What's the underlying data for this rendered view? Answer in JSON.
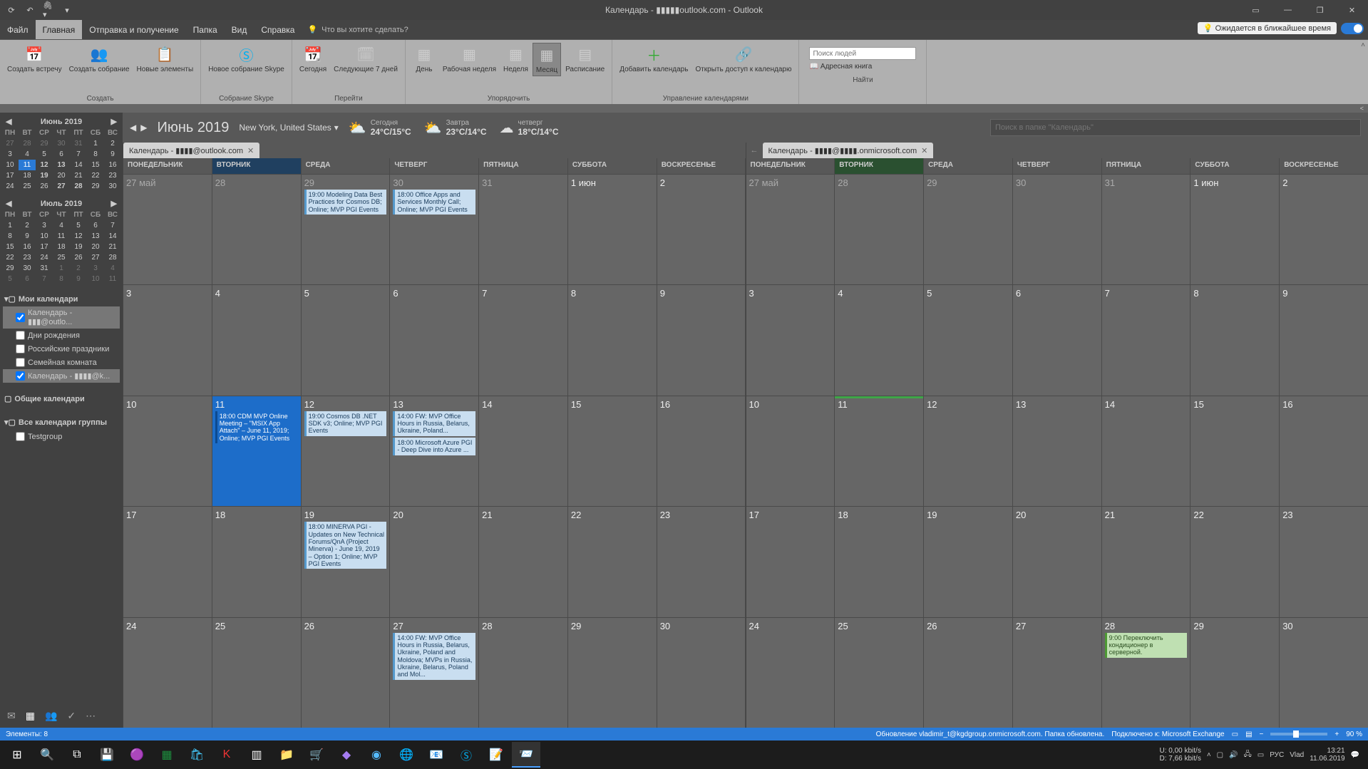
{
  "titlebar": {
    "title": "Календарь - ▮▮▮▮▮outlook.com - Outlook"
  },
  "menu": {
    "items": [
      "Файл",
      "Главная",
      "Отправка и получение",
      "Папка",
      "Вид",
      "Справка"
    ],
    "active": 1,
    "tellme": "Что вы хотите сделать?",
    "waiting": "Ожидается в ближайшее время"
  },
  "ribbon": {
    "g1": {
      "label": "Создать",
      "b1": "Создать\nвстречу",
      "b2": "Создать\nсобрание",
      "b3": "Новые\nэлементы"
    },
    "g2": {
      "label": "Собрание Skype",
      "b1": "Новое\nсобрание Skype"
    },
    "g3": {
      "label": "Перейти",
      "b1": "Сегодня",
      "b2": "Следующие\n7 дней"
    },
    "g4": {
      "label": "Упорядочить",
      "b1": "День",
      "b2": "Рабочая\nнеделя",
      "b3": "Неделя",
      "b4": "Месяц",
      "b5": "Расписание"
    },
    "g5": {
      "label": "Управление календарями",
      "b1": "Добавить\nкалендарь",
      "b2": "Открыть доступ\nк календарю"
    },
    "g6": {
      "label": "Найти",
      "search_ph": "Поиск людей",
      "addrbook": "Адресная книга"
    }
  },
  "sidebar": {
    "cal1": {
      "title": "Июнь 2019",
      "dow": [
        "ПН",
        "ВТ",
        "СР",
        "ЧТ",
        "ПТ",
        "СБ",
        "ВС"
      ],
      "days": [
        [
          "27",
          1
        ],
        [
          "28",
          1
        ],
        [
          "29",
          1
        ],
        [
          "30",
          1
        ],
        [
          "31",
          1
        ],
        [
          "1",
          0
        ],
        [
          "2",
          0
        ],
        [
          "3",
          0
        ],
        [
          "4",
          0
        ],
        [
          "5",
          0
        ],
        [
          "6",
          0
        ],
        [
          "7",
          0
        ],
        [
          "8",
          0
        ],
        [
          "9",
          0
        ],
        [
          "10",
          0
        ],
        [
          "11",
          2
        ],
        [
          "12",
          3
        ],
        [
          "13",
          3
        ],
        [
          "14",
          0
        ],
        [
          "15",
          0
        ],
        [
          "16",
          0
        ],
        [
          "17",
          0
        ],
        [
          "18",
          0
        ],
        [
          "19",
          3
        ],
        [
          "20",
          0
        ],
        [
          "21",
          0
        ],
        [
          "22",
          0
        ],
        [
          "23",
          0
        ],
        [
          "24",
          0
        ],
        [
          "25",
          0
        ],
        [
          "26",
          0
        ],
        [
          "27",
          3
        ],
        [
          "28",
          3
        ],
        [
          "29",
          0
        ],
        [
          "30",
          0
        ]
      ]
    },
    "cal2": {
      "title": "Июль 2019",
      "dow": [
        "ПН",
        "ВТ",
        "СР",
        "ЧТ",
        "ПТ",
        "СБ",
        "ВС"
      ],
      "days": [
        [
          "1",
          0
        ],
        [
          "2",
          0
        ],
        [
          "3",
          0
        ],
        [
          "4",
          0
        ],
        [
          "5",
          0
        ],
        [
          "6",
          0
        ],
        [
          "7",
          0
        ],
        [
          "8",
          0
        ],
        [
          "9",
          0
        ],
        [
          "10",
          0
        ],
        [
          "11",
          0
        ],
        [
          "12",
          0
        ],
        [
          "13",
          0
        ],
        [
          "14",
          0
        ],
        [
          "15",
          0
        ],
        [
          "16",
          0
        ],
        [
          "17",
          0
        ],
        [
          "18",
          0
        ],
        [
          "19",
          0
        ],
        [
          "20",
          0
        ],
        [
          "21",
          0
        ],
        [
          "22",
          0
        ],
        [
          "23",
          0
        ],
        [
          "24",
          0
        ],
        [
          "25",
          0
        ],
        [
          "26",
          0
        ],
        [
          "27",
          0
        ],
        [
          "28",
          0
        ],
        [
          "29",
          0
        ],
        [
          "30",
          0
        ],
        [
          "31",
          0
        ],
        [
          "1",
          1
        ],
        [
          "2",
          1
        ],
        [
          "3",
          1
        ],
        [
          "4",
          1
        ],
        [
          "5",
          1
        ],
        [
          "6",
          1
        ],
        [
          "7",
          1
        ],
        [
          "8",
          1
        ],
        [
          "9",
          1
        ],
        [
          "10",
          1
        ],
        [
          "11",
          1
        ]
      ]
    },
    "sec1": {
      "title": "Мои календари",
      "items": [
        [
          "Календарь - ▮▮▮@outlo...",
          true,
          true
        ],
        [
          "Дни рождения",
          false,
          false
        ],
        [
          "Российские праздники",
          false,
          false
        ],
        [
          "Семейная комната",
          false,
          false
        ],
        [
          "Календарь - ▮▮▮▮@k...",
          true,
          true
        ]
      ]
    },
    "sec2": {
      "title": "Общие календари"
    },
    "sec3": {
      "title": "Все календари группы",
      "items": [
        [
          "Testgroup",
          false,
          false
        ]
      ]
    }
  },
  "view": {
    "title": "Июнь 2019",
    "location": "New York, United States",
    "weather": [
      [
        "Сегодня",
        "24°C/15°C"
      ],
      [
        "Завтра",
        "23°C/14°C"
      ],
      [
        "четверг",
        "18°C/14°C"
      ]
    ],
    "search_ph": "Поиск в папке \"Календарь\""
  },
  "tabs": {
    "t1": "Календарь - ▮▮▮▮@outlook.com",
    "t2": "Календарь - ▮▮▮▮@▮▮▮▮.onmicrosoft.com"
  },
  "grid": {
    "dow": [
      "ПОНЕДЕЛЬНИК",
      "ВТОРНИК",
      "СРЕДА",
      "ЧЕТВЕРГ",
      "ПЯТНИЦА",
      "СУББОТА",
      "ВОСКРЕСЕНЬЕ"
    ],
    "today_idx": 1,
    "weeks": [
      [
        [
          "27 май",
          1
        ],
        [
          "28",
          1
        ],
        [
          "29",
          1
        ],
        [
          "30",
          1
        ],
        [
          "31",
          1
        ],
        [
          "1 июн",
          0
        ],
        [
          "2",
          0
        ]
      ],
      [
        [
          "3",
          0
        ],
        [
          "4",
          0
        ],
        [
          "5",
          0
        ],
        [
          "6",
          0
        ],
        [
          "7",
          0
        ],
        [
          "8",
          0
        ],
        [
          "9",
          0
        ]
      ],
      [
        [
          "10",
          0
        ],
        [
          "11",
          0
        ],
        [
          "12",
          0
        ],
        [
          "13",
          0
        ],
        [
          "14",
          0
        ],
        [
          "15",
          0
        ],
        [
          "16",
          0
        ]
      ],
      [
        [
          "17",
          0
        ],
        [
          "18",
          0
        ],
        [
          "19",
          0
        ],
        [
          "20",
          0
        ],
        [
          "21",
          0
        ],
        [
          "22",
          0
        ],
        [
          "23",
          0
        ]
      ],
      [
        [
          "24",
          0
        ],
        [
          "25",
          0
        ],
        [
          "26",
          0
        ],
        [
          "27",
          0
        ],
        [
          "28",
          0
        ],
        [
          "29",
          0
        ],
        [
          "30",
          0
        ]
      ]
    ]
  },
  "events_left": {
    "0_2": [
      "19:00 Modeling Data Best Practices for Cosmos DB; Online; MVP PGI Events"
    ],
    "0_3": [
      "18:00 Office Apps and Services Monthly Call; Online; MVP PGI Events"
    ],
    "2_1": [
      "18:00 CDM MVP Online Meeting – \"MSIX App Attach\" – June 11, 2019; Online; MVP PGI Events"
    ],
    "2_2": [
      "19:00 Cosmos DB .NET SDK v3; Online; MVP PGI Events"
    ],
    "2_3": [
      "14:00 FW: MVP Office Hours in Russia, Belarus, Ukraine, Poland...",
      "18:00 Microsoft Azure PGI - Deep Dive into Azure ..."
    ],
    "3_2": [
      "18:00 MINERVA PGI - Updates on New Technical Forums/QnA (Project Minerva) - June 19, 2019 – Option 1; Online; MVP PGI Events"
    ],
    "4_3": [
      "14:00 FW: MVP Office Hours in Russia, Belarus, Ukraine, Poland and Moldova; MVPs in Russia, Ukraine, Belarus, Poland and Mol..."
    ]
  },
  "events_right": {
    "4_4": [
      [
        "9:00 Переключить кондиционер в серверной.",
        "grn"
      ]
    ]
  },
  "status": {
    "items": "Элементы: 8",
    "update": "Обновление vladimir_t@kgdgroup.onmicrosoft.com.  Папка обновлена.",
    "conn": "Подключено к: Microsoft Exchange",
    "zoom": "90 %"
  },
  "tray": {
    "net1": "U:    0,00 kbit/s",
    "net2": "D:   7,66 kbit/s",
    "lang": "РУС",
    "user": "Vlad",
    "time": "13:21",
    "date": "11.06.2019"
  }
}
